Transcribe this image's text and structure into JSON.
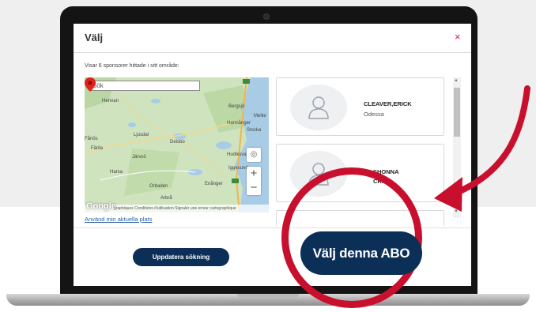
{
  "dialog": {
    "title": "Välj",
    "close_symbol": "×",
    "subtitle": "Visar 6 sponsorer hittade i sitt område:"
  },
  "map": {
    "search_placeholder": "Sök",
    "road_badge": "E4",
    "places": [
      "Hennan",
      "Bergsjö",
      "Mellie",
      "Harmånger",
      "Stocka",
      "Ljusdal",
      "Delsbo",
      "Fånös",
      "Färila",
      "Hudiksvall",
      "Järvsö",
      "Iggesund",
      "Harsa",
      "Enånger",
      "Orbaden",
      "Arbrå"
    ],
    "google_logo": "Google",
    "attribution": "Conditions d'utilisation   Signaler une erreur cartographique",
    "attribution_prefix": "graphiques",
    "zoom_in": "+",
    "zoom_out": "−",
    "locate_icon": "target-icon"
  },
  "use_location_link": "Använd min aktuella plats",
  "sponsors": [
    {
      "name": "CLEAVER,ERICK",
      "city": "Odessa",
      "selected": true
    },
    {
      "name_partial_1": "SHONNA",
      "name_partial_2": "CRAIG",
      "selected": false
    }
  ],
  "buttons": {
    "update_search": "Uppdatera sökning",
    "choose_abo": "Välj denna ABO"
  },
  "colors": {
    "primary_button": "#0c2f57",
    "highlight_circle": "#c8102e",
    "close_icon": "#d4145a",
    "link": "#2a5fa5"
  }
}
